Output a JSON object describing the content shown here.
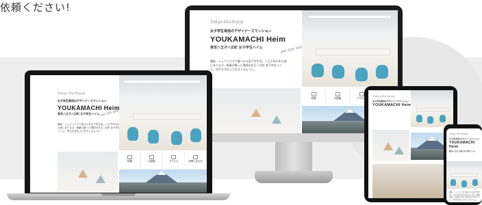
{
  "heading": "依頼ください!",
  "site": {
    "logo": "Tokyo-Hachiyoji",
    "sub_tagline": "女子学生専用のデザイナーズマンション",
    "title": "YOUKAMACHI Heim",
    "tagline": "東京八王子八日町 女子学生ハイム",
    "script_text": "we are waiting for a new lifestyle",
    "description": "講座・シェアハウスで暮らせる女子学生用。八王子市の中心部にあります。静粛の整った環境の京王八日町 女子学生ハイム。学生生活をより生きとるように。",
    "nav": [
      {
        "icon": "grid-icon",
        "label": "特徴"
      },
      {
        "icon": "room-icon",
        "label": "お部屋"
      },
      {
        "icon": "map-icon",
        "label": "アクセス"
      },
      {
        "icon": "mail-icon",
        "label": "お問い合わせ"
      }
    ]
  },
  "colors": {
    "chair": "#4aa3c0",
    "background_band": "#eeeeee"
  }
}
